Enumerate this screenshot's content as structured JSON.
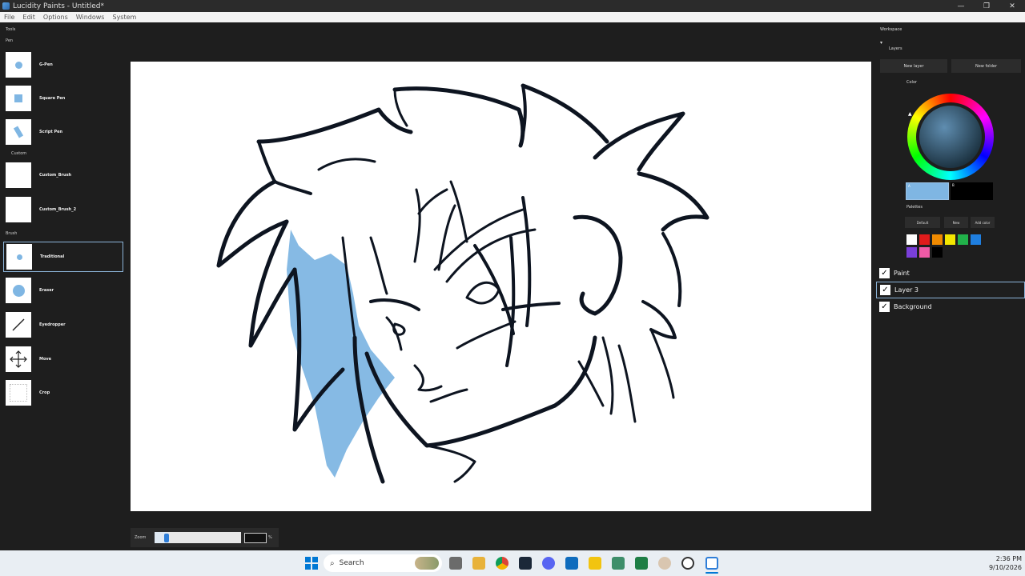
{
  "window": {
    "title": "Lucidity Paints - Untitled*",
    "minimize_glyph": "—",
    "maximize_glyph": "❐",
    "close_glyph": "✕"
  },
  "menu": [
    "File",
    "Edit",
    "Options",
    "Windows",
    "System"
  ],
  "tools_panel": {
    "title": "Tools",
    "groups": [
      {
        "label": "Pen",
        "items": [
          "G-Pen",
          "Square Pen",
          "Script Pen"
        ]
      },
      {
        "label": "Custom",
        "items": [
          "Custom_Brush",
          "Custom_Brush_2"
        ]
      },
      {
        "label": "Brush",
        "items": [
          "Traditional",
          "Eraser",
          "Eyedropper",
          "Move",
          "Crop"
        ]
      }
    ],
    "selected_tool": "Traditional"
  },
  "zoom": {
    "label": "Zoom",
    "value": "",
    "unit": "%",
    "level_fraction": 0.14
  },
  "workspace": {
    "title": "Workspace",
    "section_layers": "Layers",
    "new_layer_label": "New layer",
    "new_folder_label": "New folder",
    "color_label": "Color",
    "primary_color": "#7fb6e3",
    "secondary_color": "#000000",
    "primary_tag": "A",
    "secondary_tag": "B",
    "palettes_label": "Palettes",
    "palette_buttons": [
      "Default",
      "New",
      "Add color"
    ],
    "palette_colors": [
      "#ffffff",
      "#e01b1b",
      "#f08a00",
      "#f2e600",
      "#21b24a",
      "#1f7fe0",
      "#7a3fd9",
      "#f05aa6",
      "#000000"
    ]
  },
  "layers": [
    {
      "name": "Paint",
      "checked": true,
      "selected": false
    },
    {
      "name": "Layer 3",
      "checked": true,
      "selected": true
    },
    {
      "name": "Background",
      "checked": true,
      "selected": false
    }
  ],
  "taskbar": {
    "search_label": "Search",
    "time": "2:36 PM",
    "date": "9/10/2026",
    "accent": "#0078d4"
  },
  "colors": {
    "ink": "#0d1420",
    "fill_blue": "#7fb6e3",
    "selection_outline": "#8cb4d8",
    "app_bg": "#1e1e1e"
  }
}
